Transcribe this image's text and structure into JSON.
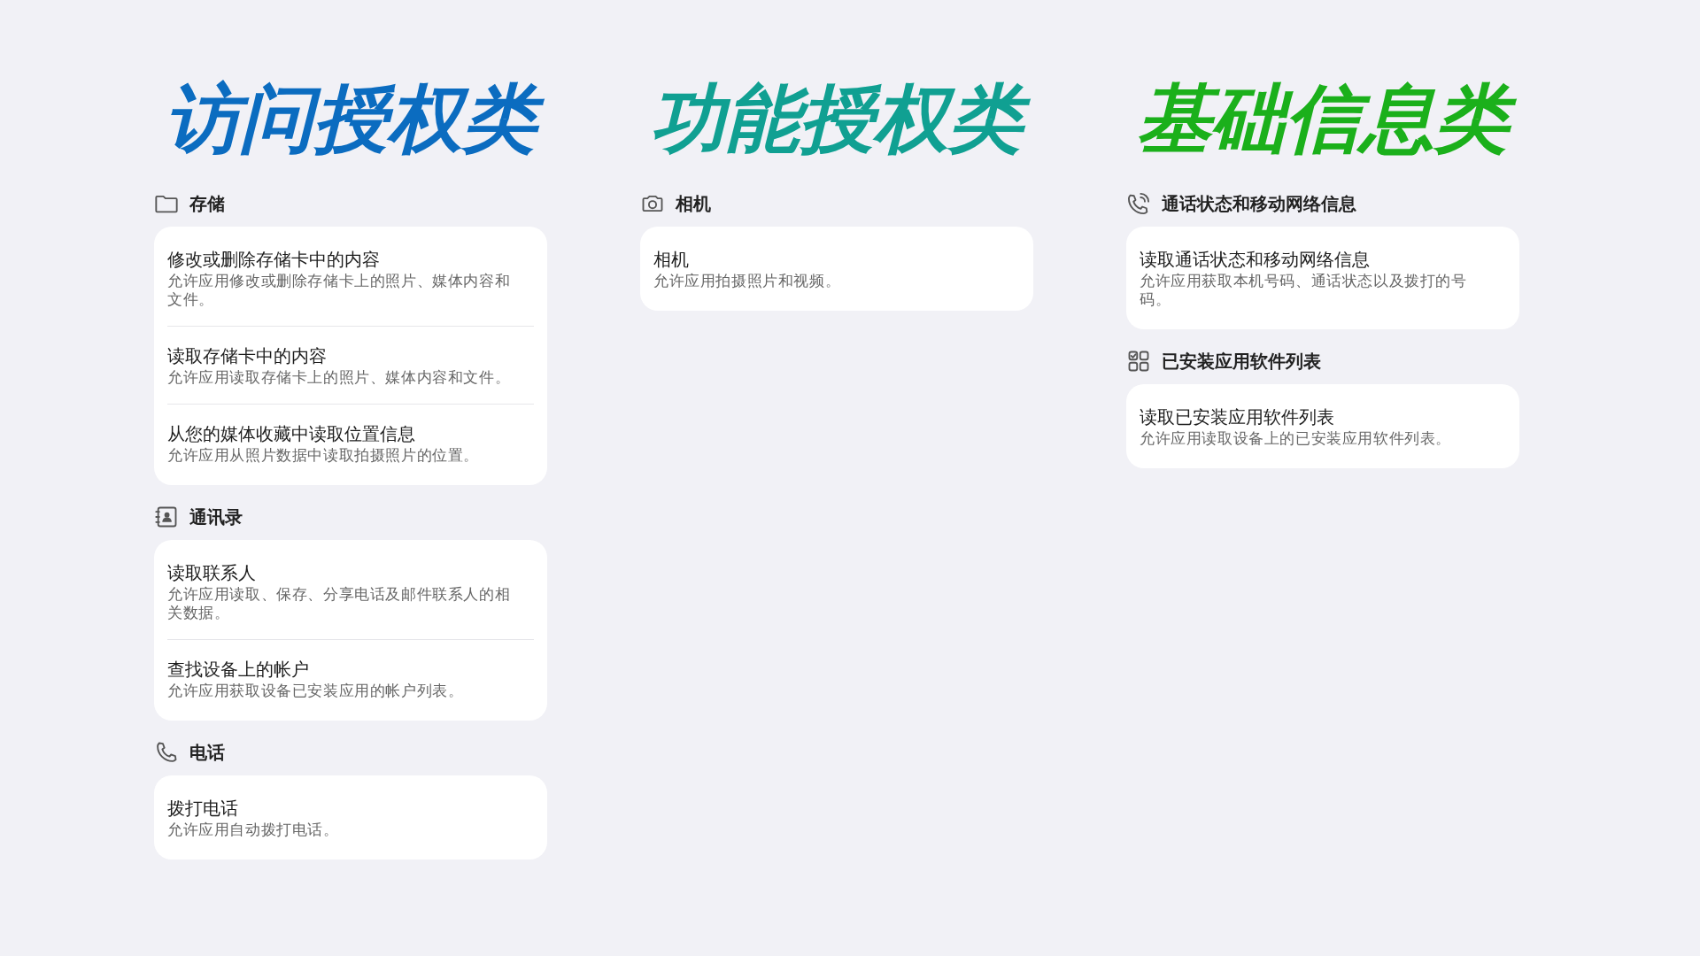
{
  "columns": [
    {
      "title": "访问授权类",
      "color": "#0b6cc0",
      "sections": [
        {
          "kind": "folder",
          "label": "存储",
          "items": [
            {
              "title": "修改或删除存储卡中的内容",
              "description": "允许应用修改或删除存储卡上的照片、媒体内容和文件。"
            },
            {
              "title": "读取存储卡中的内容",
              "description": "允许应用读取存储卡上的照片、媒体内容和文件。"
            },
            {
              "title": "从您的媒体收藏中读取位置信息",
              "description": "允许应用从照片数据中读取拍摄照片的位置。"
            }
          ]
        },
        {
          "kind": "contacts",
          "label": "通讯录",
          "items": [
            {
              "title": "读取联系人",
              "description": "允许应用读取、保存、分享电话及邮件联系人的相关数据。"
            },
            {
              "title": "查找设备上的帐户",
              "description": "允许应用获取设备已安装应用的帐户列表。"
            }
          ]
        },
        {
          "kind": "phone",
          "label": "电话",
          "items": [
            {
              "title": "拨打电话",
              "description": "允许应用自动拨打电话。"
            }
          ]
        }
      ]
    },
    {
      "title": "功能授权类",
      "color": "#10a092",
      "sections": [
        {
          "kind": "camera",
          "label": "相机",
          "items": [
            {
              "title": "相机",
              "description": "允许应用拍摄照片和视频。"
            }
          ]
        }
      ]
    },
    {
      "title": "基础信息类",
      "color": "#1bb01b",
      "sections": [
        {
          "kind": "phone-signal",
          "label": "通话状态和移动网络信息",
          "items": [
            {
              "title": "读取通话状态和移动网络信息",
              "description": "允许应用获取本机号码、通话状态以及拨打的号码。"
            }
          ]
        },
        {
          "kind": "apps",
          "label": "已安装应用软件列表",
          "items": [
            {
              "title": "读取已安装应用软件列表",
              "description": "允许应用读取设备上的已安装应用软件列表。"
            }
          ]
        }
      ]
    }
  ]
}
